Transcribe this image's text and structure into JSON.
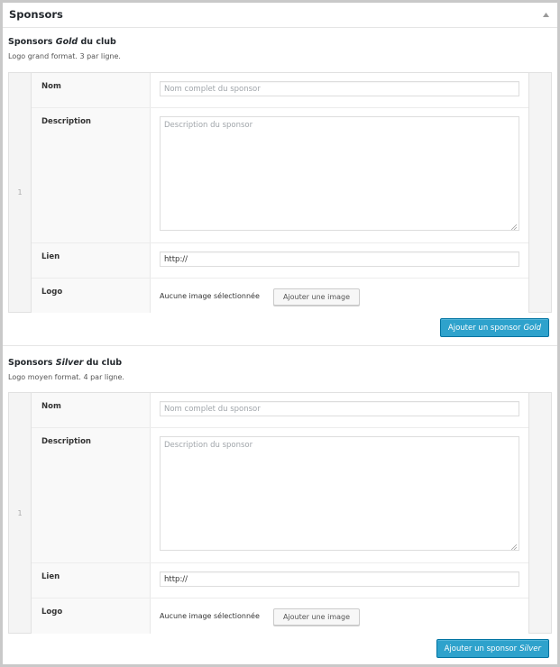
{
  "postbox": {
    "title": "Sponsors"
  },
  "sections": [
    {
      "title_prefix": "Sponsors ",
      "title_em": "Gold",
      "title_suffix": " du club",
      "description": "Logo grand format. 3 par ligne.",
      "row_number": "1",
      "fields": {
        "nom_label": "Nom",
        "nom_placeholder": "Nom complet du sponsor",
        "description_label": "Description",
        "description_placeholder": "Description du sponsor",
        "lien_label": "Lien",
        "lien_value": "http://",
        "logo_label": "Logo",
        "logo_status": "Aucune image sélectionnée",
        "logo_button": "Ajouter une image"
      },
      "add_button_prefix": "Ajouter un sponsor",
      "add_button_em": "Gold"
    },
    {
      "title_prefix": "Sponsors ",
      "title_em": "Silver",
      "title_suffix": " du club",
      "description": "Logo moyen format. 4 par ligne.",
      "row_number": "1",
      "fields": {
        "nom_label": "Nom",
        "nom_placeholder": "Nom complet du sponsor",
        "description_label": "Description",
        "description_placeholder": "Description du sponsor",
        "lien_label": "Lien",
        "lien_value": "http://",
        "logo_label": "Logo",
        "logo_status": "Aucune image sélectionnée",
        "logo_button": "Ajouter une image"
      },
      "add_button_prefix": "Ajouter un sponsor",
      "add_button_em": "Silver"
    }
  ],
  "icons": {
    "toggle": "collapse-arrow-icon",
    "resize": "resize-grip-icon"
  },
  "colors": {
    "primary_button": "#2ea2cc",
    "primary_border": "#0074a2",
    "frame_border": "#c9c9c9"
  }
}
